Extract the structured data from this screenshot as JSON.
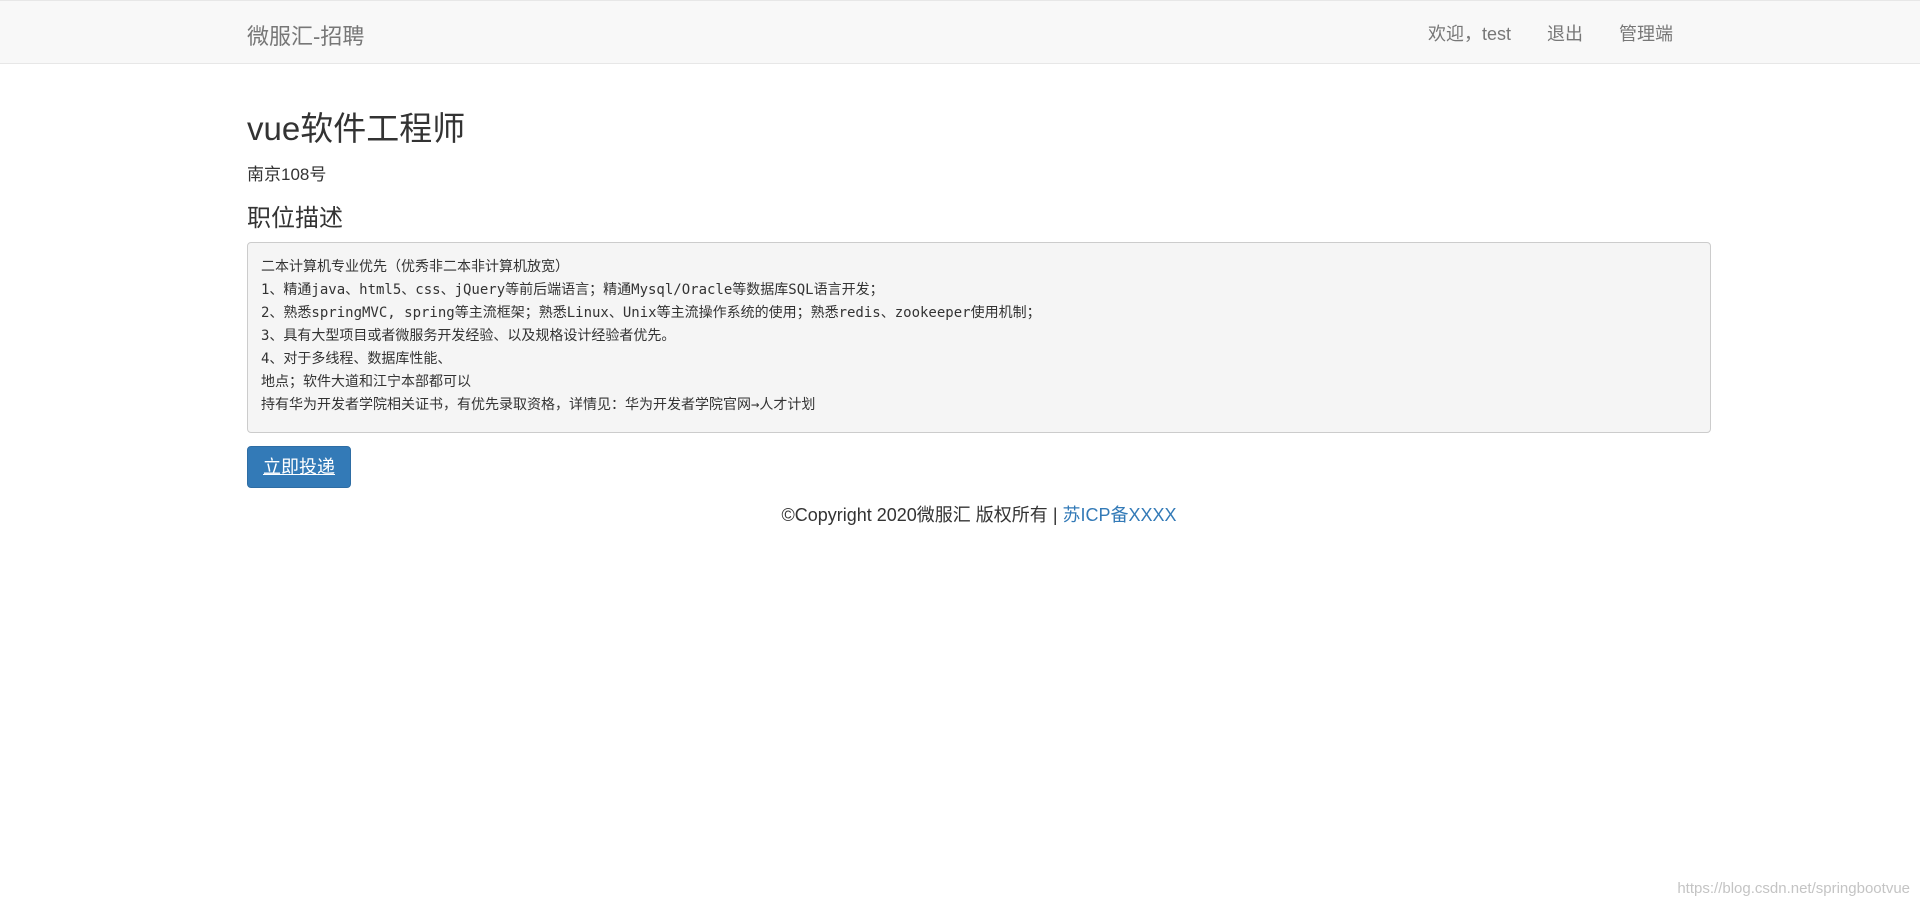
{
  "navbar": {
    "brand": "微服汇-招聘",
    "welcome": "欢迎，test",
    "logout": "退出",
    "admin": "管理端"
  },
  "job": {
    "title": "vue软件工程师",
    "location": "南京108号",
    "description_heading": "职位描述",
    "description_lines": [
      "二本计算机专业优先（优秀非二本非计算机放宽）",
      "1、精通java、html5、css、jQuery等前后端语言；精通Mysql/Oracle等数据库SQL语言开发；",
      "2、熟悉springMVC, spring等主流框架；熟悉Linux、Unix等主流操作系统的使用；熟悉redis、zookeeper使用机制；",
      "3、具有大型项目或者微服务开发经验、以及规格设计经验者优先。",
      "4、对于多线程、数据库性能、",
      "地点；软件大道和江宁本部都可以",
      "持有华为开发者学院相关证书，有优先录取资格，详情见：华为开发者学院官网→人才计划"
    ],
    "apply_label": "立即投递"
  },
  "footer": {
    "copyright": "©Copyright 2020微服汇 版权所有 | ",
    "icp_link": "苏ICP备XXXX"
  },
  "watermark": "https://blog.csdn.net/springbootvue",
  "colors": {
    "navbar_bg": "#f8f8f8",
    "primary": "#337ab7",
    "text": "#333333",
    "muted": "#777777"
  }
}
